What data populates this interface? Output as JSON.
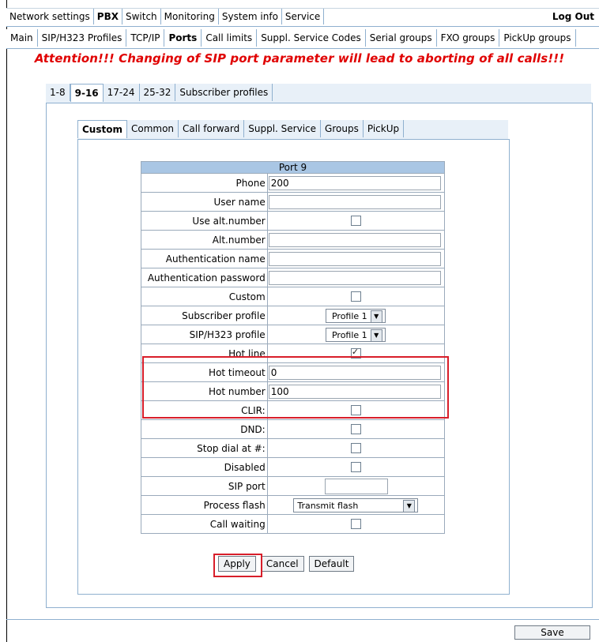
{
  "top_tabs": [
    "Network settings",
    "PBX",
    "Switch",
    "Monitoring",
    "System info",
    "Service"
  ],
  "logout": "Log Out",
  "sub_tabs": [
    "Main",
    "SIP/H323 Profiles",
    "TCP/IP",
    "Ports",
    "Call limits",
    "Suppl. Service Codes",
    "Serial groups",
    "FXO groups",
    "PickUp groups"
  ],
  "attention": "Attention!!! Changing of SIP port parameter will lead to aborting of all calls!!!",
  "port_tabs": [
    "1-8",
    "9-16",
    "17-24",
    "25-32",
    "Subscriber profiles"
  ],
  "inner_tabs": [
    "Custom",
    "Common",
    "Call forward",
    "Suppl. Service",
    "Groups",
    "PickUp"
  ],
  "port_header": "Port 9",
  "fields": {
    "phone_label": "Phone",
    "phone_value": "200",
    "user_name_label": "User name",
    "use_alt_label": "Use alt.number",
    "alt_number_label": "Alt.number",
    "auth_name_label": "Authentication name",
    "auth_password_label": "Authentication password",
    "custom_label": "Custom",
    "subscriber_profile_label": "Subscriber profile",
    "subscriber_profile_value": "Profile 1",
    "sip_profile_label": "SIP/H323 profile",
    "sip_profile_value": "Profile 1",
    "hot_line_label": "Hot line",
    "hot_timeout_label": "Hot timeout",
    "hot_timeout_value": "0",
    "hot_number_label": "Hot number",
    "hot_number_value": "100",
    "clir_label": "CLIR:",
    "dnd_label": "DND:",
    "stop_dial_label": "Stop dial at #:",
    "disabled_label": "Disabled",
    "sip_port_label": "SIP port",
    "process_flash_label": "Process flash",
    "process_flash_value": "Transmit flash",
    "call_waiting_label": "Call waiting"
  },
  "buttons": {
    "apply": "Apply",
    "cancel": "Cancel",
    "default": "Default",
    "save": "Save"
  }
}
